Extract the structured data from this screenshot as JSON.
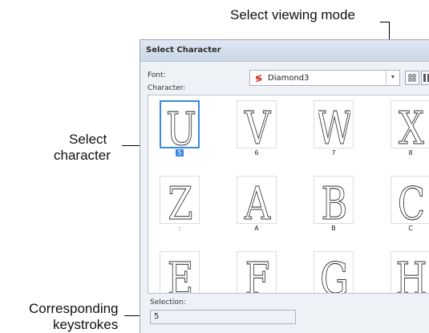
{
  "callouts": {
    "view_mode": "Select viewing mode",
    "select_char_line1": "Select",
    "select_char_line2": "character",
    "keystrokes_line1": "Corresponding",
    "keystrokes_line2": "keystrokes"
  },
  "dialog": {
    "title": "Select Character",
    "font_label": "Font:",
    "font_value": "Diamond3",
    "character_label": "Character:",
    "selection_label": "Selection:",
    "selection_value": "5"
  },
  "characters": [
    {
      "key": "5",
      "glyph": "U",
      "selected": true
    },
    {
      "key": "6",
      "glyph": "V"
    },
    {
      "key": "7",
      "glyph": "W"
    },
    {
      "key": "8",
      "glyph": "X"
    },
    {
      "key": ":",
      "glyph": "Z"
    },
    {
      "key": "A",
      "glyph": "A"
    },
    {
      "key": "B",
      "glyph": "B"
    },
    {
      "key": "C",
      "glyph": "C"
    },
    {
      "key": "",
      "glyph": "E"
    },
    {
      "key": "",
      "glyph": "F"
    },
    {
      "key": "",
      "glyph": "G"
    },
    {
      "key": "",
      "glyph": "H"
    }
  ],
  "colors": {
    "selection": "#3a88e0",
    "font_icon": "#d0302a"
  }
}
